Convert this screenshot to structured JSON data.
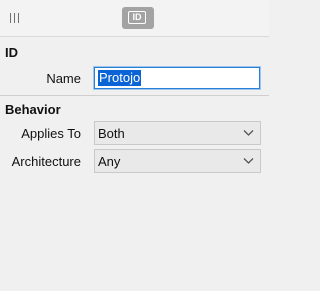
{
  "toolbar": {
    "grip_icon": "grip-icon",
    "active_tab_icon": "id-icon",
    "active_tab_text": "ID"
  },
  "sections": {
    "id": {
      "title": "ID",
      "name_label": "Name",
      "name_value": "Protojo"
    },
    "behavior": {
      "title": "Behavior",
      "applies_to_label": "Applies To",
      "applies_to_value": "Both",
      "architecture_label": "Architecture",
      "architecture_value": "Any"
    }
  },
  "colors": {
    "selection": "#0a64d6",
    "focus_border": "#2a7fd6",
    "tab_background": "#a3a3a3"
  }
}
